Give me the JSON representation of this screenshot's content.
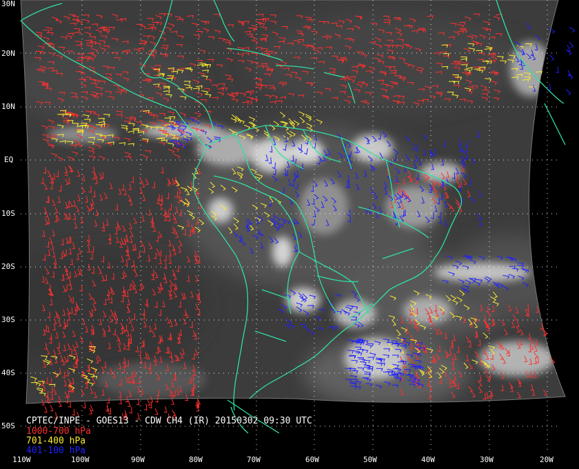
{
  "image": {
    "title": "CPTEC/INPE - GOES13 - CDW CH4 (IR) 20150302 09:30 UTC"
  },
  "legend": [
    {
      "label": "1000-700 hPa",
      "color": "#ff3030"
    },
    {
      "label": "701-400 hPa",
      "color": "#ffee30"
    },
    {
      "label": "401-100 hPa",
      "color": "#2020ff"
    }
  ],
  "lat_labels": [
    "30N",
    "20N",
    "10N",
    "EQ",
    "10S",
    "20S",
    "30S",
    "40S",
    "50S"
  ],
  "lon_labels": [
    "110W",
    "100W",
    "90W",
    "80W",
    "70W",
    "60W",
    "50W",
    "40W",
    "30W",
    "20W"
  ],
  "colors": {
    "background": "#000000",
    "coastline": "#30e0a0",
    "grid": "#ffffff",
    "label_text": "#ffffff"
  }
}
